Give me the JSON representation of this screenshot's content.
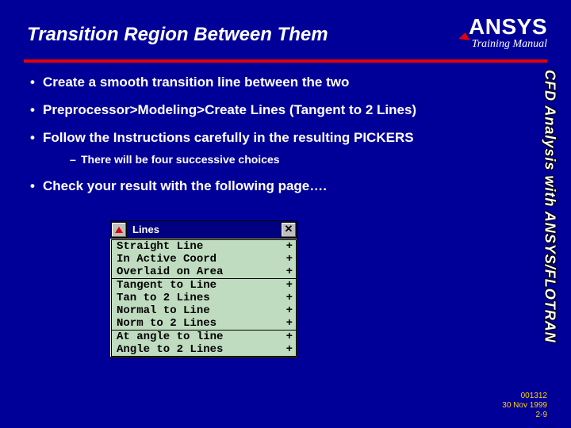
{
  "header": {
    "title": "Transition Region Between Them",
    "brand": "ANSYS",
    "subbrand": "Training Manual"
  },
  "side_label": "CFD Analysis with ANSYS/FLOTRAN",
  "bullets": [
    "Create a smooth transition line between the two",
    "Preprocessor>Modeling>Create Lines (Tangent to 2 Lines)",
    "Follow the Instructions carefully in the resulting PICKERS",
    "Check your result with the following page…."
  ],
  "subbullet": "There will be four successive choices",
  "menu": {
    "title": "Lines",
    "groups": [
      [
        "Straight Line",
        "In Active Coord",
        "Overlaid on Area"
      ],
      [
        "Tangent to Line",
        "Tan to 2 Lines",
        "Normal to Line",
        "Norm to 2 Lines"
      ],
      [
        "At angle to line",
        "Angle to 2 Lines"
      ]
    ]
  },
  "footer": {
    "l1": "001312",
    "l2": "30 Nov 1999",
    "l3": "2-9"
  }
}
